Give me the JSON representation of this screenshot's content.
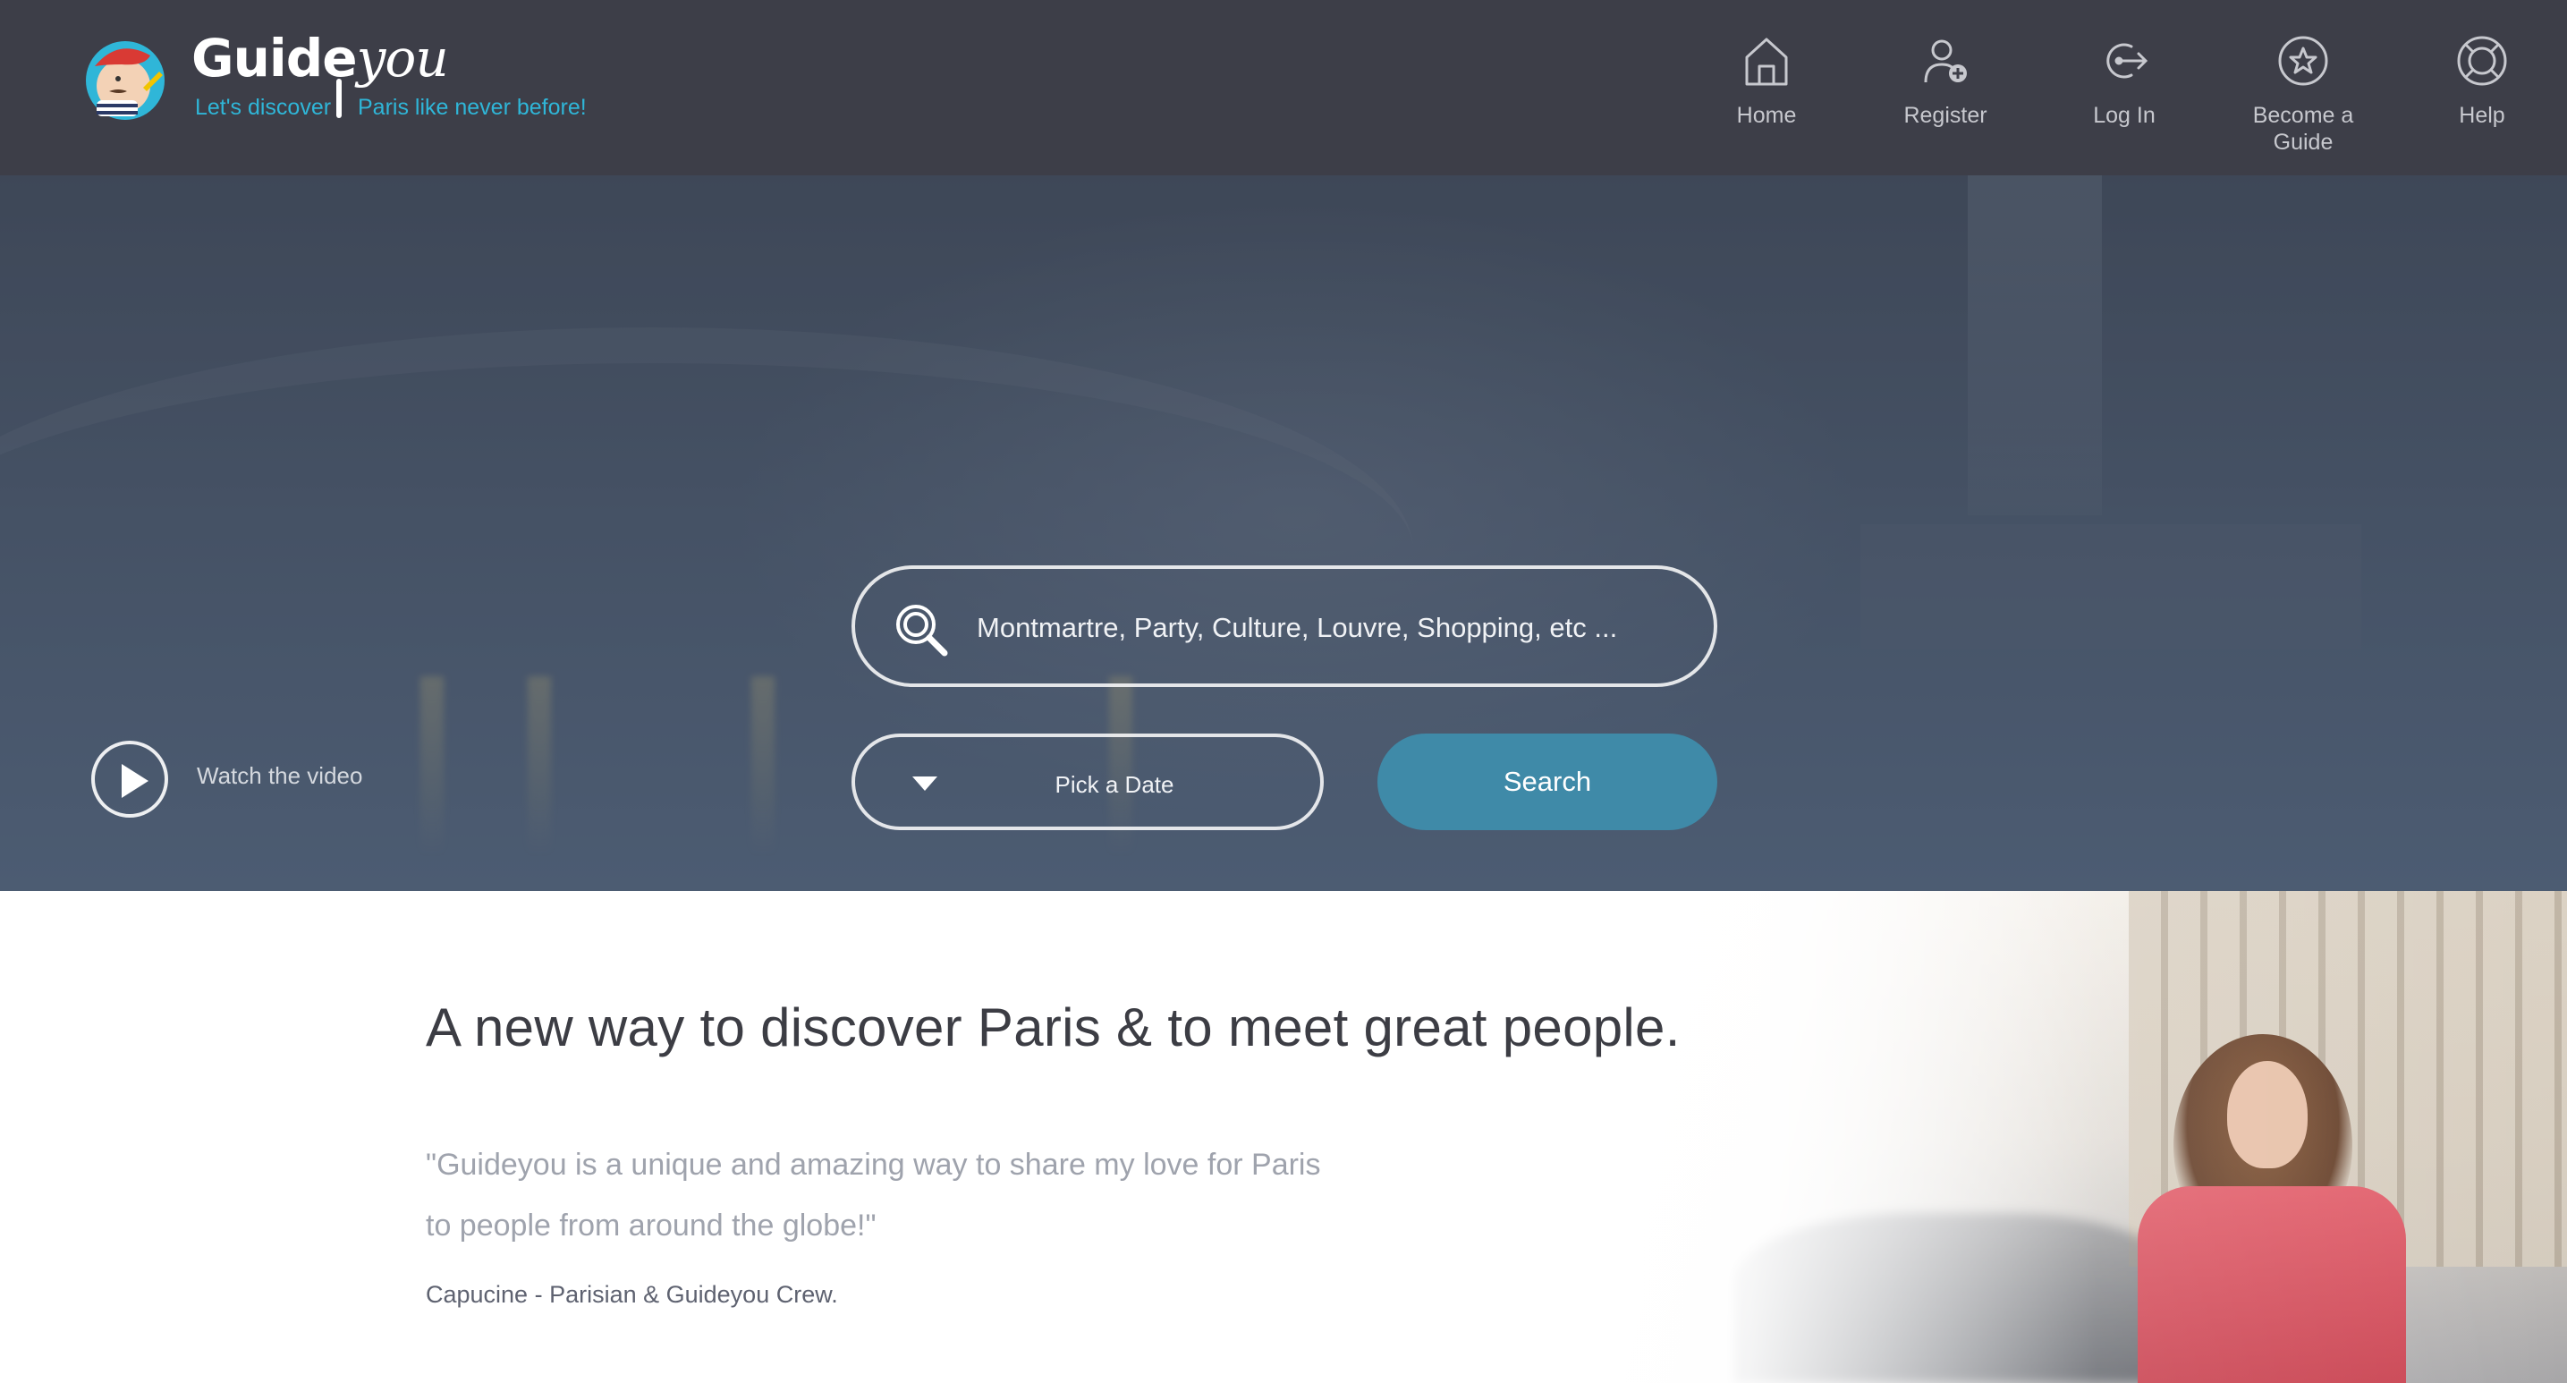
{
  "brand": {
    "logo_main": "Guide",
    "logo_script": "you",
    "tagline_left": "Let's discover",
    "tagline_right": "Paris like never before!",
    "accent_color": "#2fb6d8",
    "header_bg": "#3d3e48"
  },
  "nav": {
    "items": [
      {
        "label": "Home",
        "icon": "home-icon"
      },
      {
        "label": "Register",
        "icon": "add-user-icon"
      },
      {
        "label": "Log In",
        "icon": "login-icon"
      },
      {
        "label": "Become a Guide",
        "icon": "star-icon"
      },
      {
        "label": "Help",
        "icon": "lifebuoy-icon"
      }
    ]
  },
  "hero": {
    "search_placeholder": "Montmartre, Party, Culture, Louvre, Shopping, etc ...",
    "date_placeholder": "Pick a Date",
    "search_button": "Search",
    "search_button_color": "#3f8aa8",
    "video_label": "Watch the video"
  },
  "intro": {
    "headline": "A new way to discover Paris & to meet great people.",
    "quote_line1": "\"Guideyou is a unique and amazing way to share my love for Paris",
    "quote_line2": "to people from around the globe!\"",
    "author": "Capucine - Parisian & Guideyou Crew."
  }
}
